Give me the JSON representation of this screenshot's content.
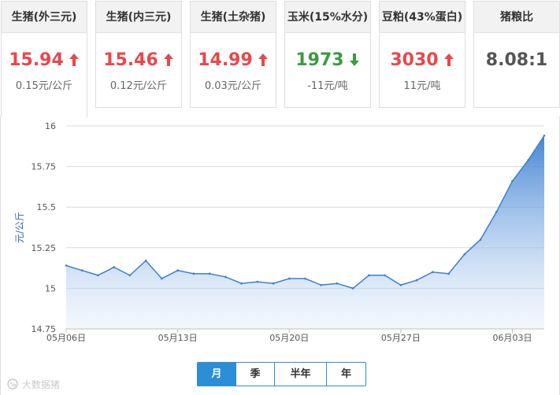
{
  "cards": [
    {
      "name": "生猪(外三元)",
      "price": "15.94",
      "trend": "up",
      "change": "0.15元/公斤",
      "active": true
    },
    {
      "name": "生猪(内三元)",
      "price": "15.46",
      "trend": "up",
      "change": "0.12元/公斤",
      "active": false
    },
    {
      "name": "生猪(土杂猪)",
      "price": "14.99",
      "trend": "up",
      "change": "0.03元/公斤",
      "active": false
    },
    {
      "name": "玉米(15%水分)",
      "price": "1973",
      "trend": "down",
      "change": "-11元/吨",
      "active": false
    },
    {
      "name": "豆粕(43%蛋白)",
      "price": "3030",
      "trend": "up",
      "change": "11元/吨",
      "active": false
    },
    {
      "name": "猪粮比",
      "price": "8.08:1",
      "trend": "none",
      "change": "",
      "active": false
    }
  ],
  "colors": {
    "up": "#e8474b",
    "down": "#3a9b40",
    "accent": "#2b8ed6",
    "line": "#3b7fd3"
  },
  "tabs": [
    {
      "label": "月",
      "selected": true
    },
    {
      "label": "季",
      "selected": false
    },
    {
      "label": "半年",
      "selected": false
    },
    {
      "label": "年",
      "selected": false
    }
  ],
  "watermark": "大数据猪",
  "chart_data": {
    "type": "area",
    "title": "",
    "xlabel": "",
    "ylabel": "元/公斤",
    "ylim": [
      14.75,
      16
    ],
    "yticks": [
      "14.75",
      "15",
      "15.25",
      "15.5",
      "15.75",
      "16"
    ],
    "grid": true,
    "x_tick_labels": [
      "05月06日",
      "05月13日",
      "05月20日",
      "05月27日",
      "06月03日"
    ],
    "x_tick_index": [
      0,
      7,
      14,
      21,
      28
    ],
    "series": [
      {
        "values": [
          15.14,
          15.11,
          15.08,
          15.13,
          15.08,
          15.17,
          15.06,
          15.11,
          15.09,
          15.09,
          15.07,
          15.03,
          15.04,
          15.03,
          15.06,
          15.06,
          15.02,
          15.03,
          15.0,
          15.08,
          15.08,
          15.02,
          15.05,
          15.1,
          15.09,
          15.21,
          15.3,
          15.47,
          15.66,
          15.79,
          15.94
        ]
      }
    ]
  }
}
